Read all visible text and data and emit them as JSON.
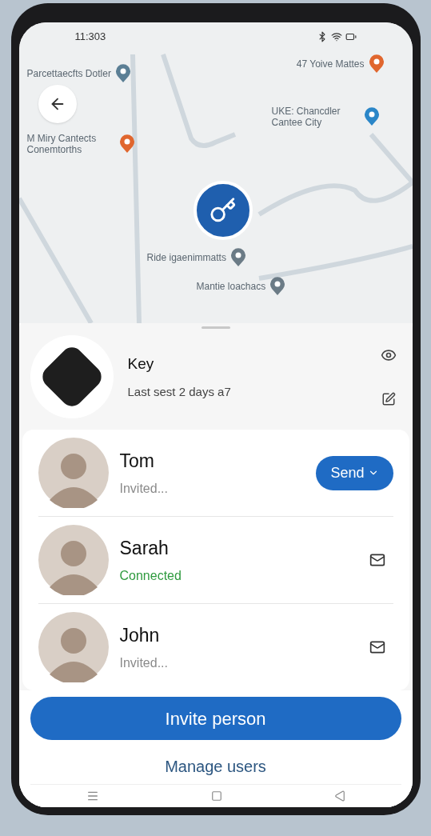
{
  "status_bar": {
    "time": "11:303"
  },
  "map": {
    "labels": [
      {
        "text": "Parcettaecfts Dotler",
        "color": "#5b7f95"
      },
      {
        "text": "47 Yoive Mattes",
        "color": "#e0662e"
      },
      {
        "text": "UKE: Chancdler Cantee City",
        "color": "#2a86c8"
      },
      {
        "text": "M Miry Cantects Conemtorths",
        "color": "#e0662e"
      },
      {
        "text": "Ride igaenimmatts",
        "color": "#6b7b86"
      },
      {
        "text": "Mantie loachacs",
        "color": "#6b7b86"
      }
    ]
  },
  "device": {
    "name": "Key",
    "subtitle": "Last sest 2 days a7"
  },
  "people": [
    {
      "name": "Tom",
      "status": "Invited...",
      "connected": false,
      "kind": "send",
      "action": "Send"
    },
    {
      "name": "Sarah",
      "status": "Connected",
      "connected": true,
      "kind": "mail"
    },
    {
      "name": "John",
      "status": "Invited...",
      "connected": false,
      "kind": "mail"
    }
  ],
  "primary_button": "Invite person",
  "secondary_link": "Manage users"
}
